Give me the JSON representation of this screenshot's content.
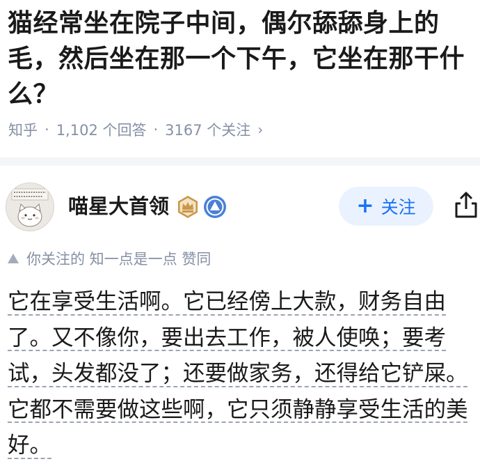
{
  "question": {
    "title": "猫经常坐在院子中间，偶尔舔舔身上的毛，然后坐在那一个下午，它坐在那干什么？",
    "platform": "知乎",
    "answers_count": "1,102 个回答",
    "followers_count": "3167 个关注",
    "separator": "·",
    "chevron": "›"
  },
  "author": {
    "name": "喵星大首领",
    "follow_label": "关注",
    "follow_plus": "+",
    "avatar_text": [
      "我仅为自己代言",
      "如此而已"
    ]
  },
  "upvote": {
    "text": "你关注的 知一点是一点 赞同"
  },
  "answer": {
    "text": "它在享受生活啊。它已经傍上大款，财务自由了。又不像你，要出去工作，被人使唤；要考试，头发都没了；还要做家务，还得给它铲屎。它都不需要做这些啊，它只须静静享受生活的美好。"
  },
  "colors": {
    "blue_accent": "#1772f6",
    "meta_gray": "#8590a6",
    "crown_badge": "#c9974a",
    "shield_badge": "#4a7fd6"
  },
  "icons": [
    "crown-badge-icon",
    "shield-badge-icon",
    "share-icon",
    "upvote-triangle-icon",
    "chevron-right-icon"
  ]
}
